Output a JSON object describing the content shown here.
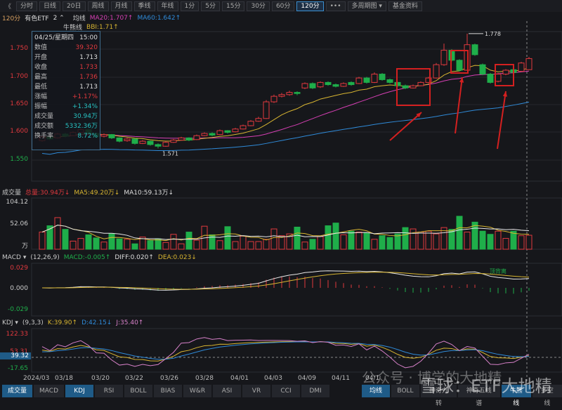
{
  "toolbar": {
    "back": "《",
    "buttons": [
      "分时",
      "日线",
      "20日",
      "周线",
      "月线",
      "季线",
      "年线",
      "1分",
      "5分",
      "15分",
      "30分",
      "60分",
      "120分"
    ],
    "active": "120分",
    "more": "•••",
    "multi": "多周期图 ▾",
    "fund": "基金资料"
  },
  "header": {
    "period": "120分",
    "name": "有色ETF",
    "count": "2 ⌃",
    "ma_label": "均线",
    "ma20": "MA20:1.707↑",
    "ma60": "MA60:1.642↑",
    "bbi_label": "牛熊线",
    "bbi": "BBI:1.71↑"
  },
  "colors": {
    "up": "#e0393e",
    "down": "#1fae4a",
    "ma20": "#d63fb4",
    "ma60": "#2f8ad8",
    "bbi": "#d8b531",
    "accent": "#1f5b87"
  },
  "price_axis": [
    "1.750",
    "1.700",
    "1.650",
    "1.600",
    "1.550"
  ],
  "annotations": {
    "high": "1.778",
    "low": "1.571"
  },
  "info": {
    "date": "04/25/星期四",
    "time": "15:00",
    "rows": [
      {
        "label": "数值",
        "value": "39.320",
        "color": "#e0393e"
      },
      {
        "label": "开盘",
        "value": "1.713",
        "color": "#ddd"
      },
      {
        "label": "收盘",
        "value": "1.733",
        "color": "#e0393e"
      },
      {
        "label": "最高",
        "value": "1.736",
        "color": "#e0393e"
      },
      {
        "label": "最低",
        "value": "1.713",
        "color": "#ddd"
      },
      {
        "label": "涨幅",
        "value": "+1.17%",
        "color": "#e0393e"
      },
      {
        "label": "振幅",
        "value": "+1.34%",
        "color": "#27c0c0"
      },
      {
        "label": "成交量",
        "value": "30.94万",
        "color": "#27c0c0"
      },
      {
        "label": "成交额",
        "value": "5332.36万",
        "color": "#27c0c0"
      },
      {
        "label": "换手率",
        "value": "8.72%",
        "color": "#27c0c0"
      }
    ]
  },
  "volume": {
    "title": "成交量",
    "total": "总量:30.94万↓",
    "ma5": "MA5:49.20万↓",
    "ma10": "MA10:59.13万↓",
    "axis": [
      "104.12",
      "52.06",
      "万"
    ]
  },
  "macd": {
    "title": "MACD ▾",
    "params": "(12,26,9)",
    "macd": "MACD:-0.005↑",
    "diff": "DIFF:0.020↑",
    "dea": "DEA:0.023↓",
    "axis": [
      "0.029",
      "0.000",
      "-0.029"
    ],
    "note": "顶背离"
  },
  "kdj": {
    "title": "KDJ ▾",
    "params": "(9,3,3)",
    "k": "K:39.90↑",
    "d": "D:42.15↓",
    "j": "J:35.40↑",
    "axis": [
      "122.33",
      "53.31",
      "39.32",
      "-17.65"
    ]
  },
  "dates": [
    "2024/03",
    "03/18",
    "03/20",
    "03/22",
    "03/26",
    "03/28",
    "04/01",
    "04/03",
    "04/09",
    "04/11",
    "04/1"
  ],
  "bottom_tabs": [
    "成交量",
    "MACD",
    "KDJ",
    "RSI",
    "BOLL",
    "BIAS",
    "W&R",
    "ASI",
    "VR",
    "CCI",
    "DMI"
  ],
  "bottom_tabs_active": [
    "成交量",
    "KDJ"
  ],
  "right_tabs": [
    "均线",
    "BOLL",
    "神奇九转",
    "神奇五线谱",
    "牛熊线",
    "多空线"
  ],
  "right_tabs_active": [
    "均线",
    "牛熊线"
  ],
  "watermark": "雪球：ETF大地精",
  "watermark2": "公众号 · 博学的大地精",
  "chart_data": {
    "type": "candlestick",
    "ohlc": [
      [
        1.585,
        1.594,
        1.583,
        1.592
      ],
      [
        1.592,
        1.594,
        1.586,
        1.588
      ],
      [
        1.59,
        1.599,
        1.589,
        1.597
      ],
      [
        1.597,
        1.599,
        1.591,
        1.593
      ],
      [
        1.594,
        1.602,
        1.593,
        1.6
      ],
      [
        1.6,
        1.607,
        1.599,
        1.605
      ],
      [
        1.605,
        1.606,
        1.596,
        1.598
      ],
      [
        1.598,
        1.599,
        1.59,
        1.592
      ],
      [
        1.593,
        1.598,
        1.591,
        1.596
      ],
      [
        1.596,
        1.597,
        1.588,
        1.59
      ],
      [
        1.59,
        1.591,
        1.582,
        1.584
      ],
      [
        1.585,
        1.59,
        1.583,
        1.588
      ],
      [
        1.588,
        1.589,
        1.578,
        1.58
      ],
      [
        1.58,
        1.586,
        1.579,
        1.584
      ],
      [
        1.584,
        1.585,
        1.576,
        1.578
      ],
      [
        1.578,
        1.58,
        1.571,
        1.575
      ],
      [
        1.575,
        1.584,
        1.574,
        1.582
      ],
      [
        1.582,
        1.588,
        1.581,
        1.586
      ],
      [
        1.586,
        1.592,
        1.585,
        1.59
      ],
      [
        1.59,
        1.591,
        1.584,
        1.586
      ],
      [
        1.587,
        1.596,
        1.586,
        1.594
      ],
      [
        1.594,
        1.6,
        1.593,
        1.598
      ],
      [
        1.598,
        1.6,
        1.593,
        1.595
      ],
      [
        1.596,
        1.605,
        1.595,
        1.603
      ],
      [
        1.603,
        1.604,
        1.598,
        1.6
      ],
      [
        1.601,
        1.608,
        1.6,
        1.606
      ],
      [
        1.606,
        1.614,
        1.605,
        1.612
      ],
      [
        1.612,
        1.622,
        1.611,
        1.62
      ],
      [
        1.62,
        1.628,
        1.619,
        1.625
      ],
      [
        1.625,
        1.658,
        1.624,
        1.655
      ],
      [
        1.655,
        1.668,
        1.653,
        1.665
      ],
      [
        1.665,
        1.671,
        1.663,
        1.668
      ],
      [
        1.668,
        1.675,
        1.666,
        1.672
      ],
      [
        1.672,
        1.674,
        1.667,
        1.67
      ],
      [
        1.68,
        1.69,
        1.678,
        1.688
      ],
      [
        1.688,
        1.69,
        1.678,
        1.68
      ],
      [
        1.682,
        1.692,
        1.68,
        1.69
      ],
      [
        1.69,
        1.692,
        1.684,
        1.686
      ],
      [
        1.686,
        1.688,
        1.681,
        1.683
      ],
      [
        1.683,
        1.69,
        1.682,
        1.688
      ],
      [
        1.69,
        1.692,
        1.684,
        1.686
      ],
      [
        1.688,
        1.7,
        1.687,
        1.698
      ],
      [
        1.698,
        1.7,
        1.688,
        1.69
      ],
      [
        1.69,
        1.708,
        1.689,
        1.705
      ],
      [
        1.705,
        1.707,
        1.693,
        1.695
      ],
      [
        1.695,
        1.697,
        1.688,
        1.69
      ],
      [
        1.69,
        1.691,
        1.682,
        1.684
      ],
      [
        1.684,
        1.686,
        1.678,
        1.68
      ],
      [
        1.68,
        1.686,
        1.679,
        1.684
      ],
      [
        1.684,
        1.692,
        1.683,
        1.69
      ],
      [
        1.69,
        1.7,
        1.689,
        1.698
      ],
      [
        1.698,
        1.725,
        1.697,
        1.722
      ],
      [
        1.722,
        1.76,
        1.72,
        1.748
      ],
      [
        1.748,
        1.75,
        1.728,
        1.73
      ],
      [
        1.73,
        1.732,
        1.71,
        1.712
      ],
      [
        1.712,
        1.778,
        1.711,
        1.758
      ],
      [
        1.758,
        1.76,
        1.738,
        1.74
      ],
      [
        1.722,
        1.724,
        1.703,
        1.705
      ],
      [
        1.705,
        1.707,
        1.688,
        1.69
      ],
      [
        1.692,
        1.707,
        1.69,
        1.705
      ],
      [
        1.705,
        1.714,
        1.703,
        1.712
      ],
      [
        1.713,
        1.715,
        1.705,
        1.708
      ],
      [
        1.71,
        1.727,
        1.709,
        1.725
      ],
      [
        1.713,
        1.736,
        1.713,
        1.733
      ]
    ],
    "volume": [
      38,
      52,
      70,
      44,
      18,
      24,
      32,
      25,
      16,
      34,
      23,
      22,
      12,
      27,
      19,
      23,
      15,
      33,
      12,
      38,
      20,
      51,
      32,
      19,
      50,
      17,
      29,
      17,
      17,
      22,
      45,
      30,
      34,
      49,
      16,
      22,
      28,
      52,
      58,
      32,
      40,
      38,
      36,
      22,
      30,
      26,
      34,
      48,
      45,
      38,
      40,
      34,
      48,
      44,
      73,
      38,
      60,
      40,
      33,
      40,
      24,
      40,
      30,
      31
    ]
  }
}
